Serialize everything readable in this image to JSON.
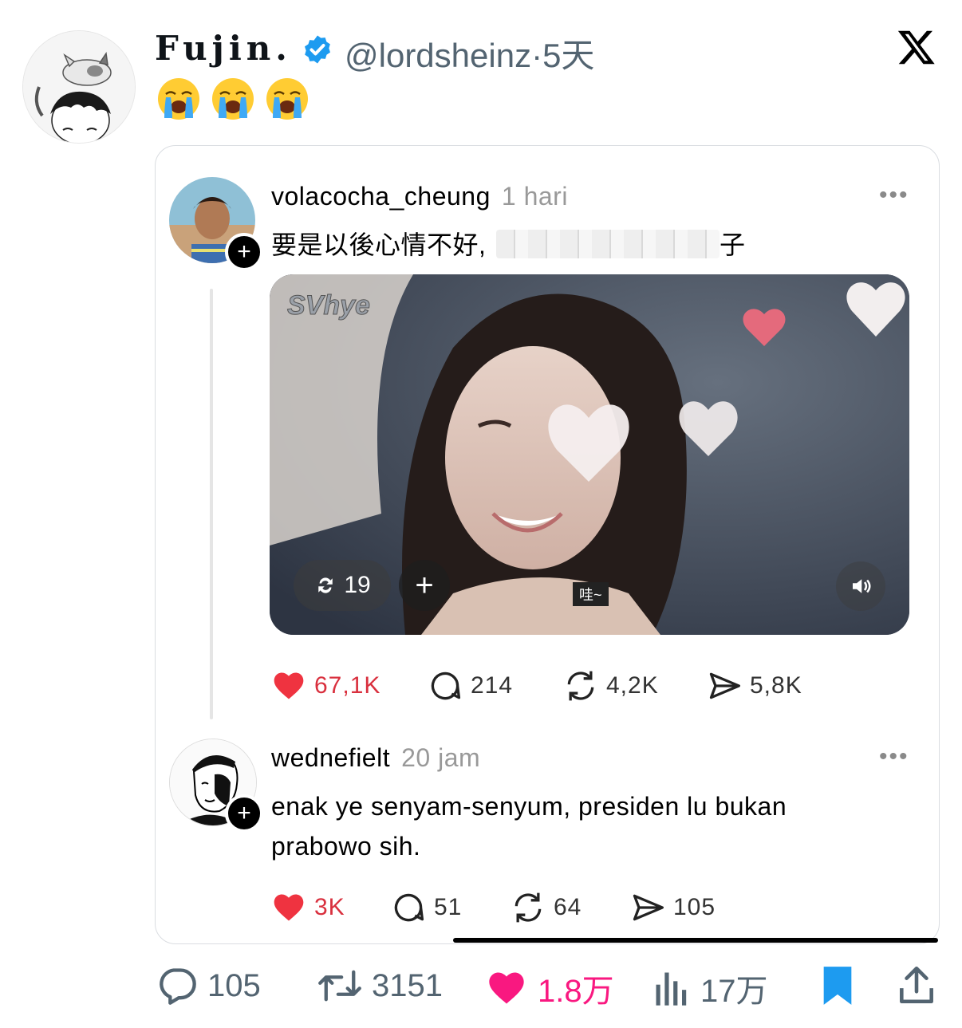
{
  "outer_tweet": {
    "display_name": "Fujin.",
    "handle": "@lordsheinz",
    "separator": "·",
    "time": "5天",
    "emoji_text": "😭😭😭"
  },
  "thread_post": {
    "username": "volacocha_cheung",
    "time": "1 hari",
    "text_before": "要是以後心情不好,",
    "text_after": "子",
    "video": {
      "watermark": "SVhye",
      "repost_count": "19",
      "subtitle": "哇~"
    },
    "actions": {
      "likes": "67,1K",
      "replies": "214",
      "reposts": "4,2K",
      "shares": "5,8K"
    }
  },
  "reply_post": {
    "username": "wednefielt",
    "time": "20 jam",
    "text_line1": "enak ye senyam-senyum, presiden lu bukan",
    "text_line2": "prabowo sih.",
    "actions": {
      "likes": "3K",
      "replies": "51",
      "reposts": "64",
      "shares": "105"
    }
  },
  "outer_actions": {
    "replies": "105",
    "retweets": "3151",
    "likes": "1.8万",
    "views": "17万"
  },
  "colors": {
    "verified": "#1d9bf0",
    "like_pink": "#f91880",
    "heart_red": "#ef3340",
    "bookmark_blue": "#1d9bf0"
  }
}
